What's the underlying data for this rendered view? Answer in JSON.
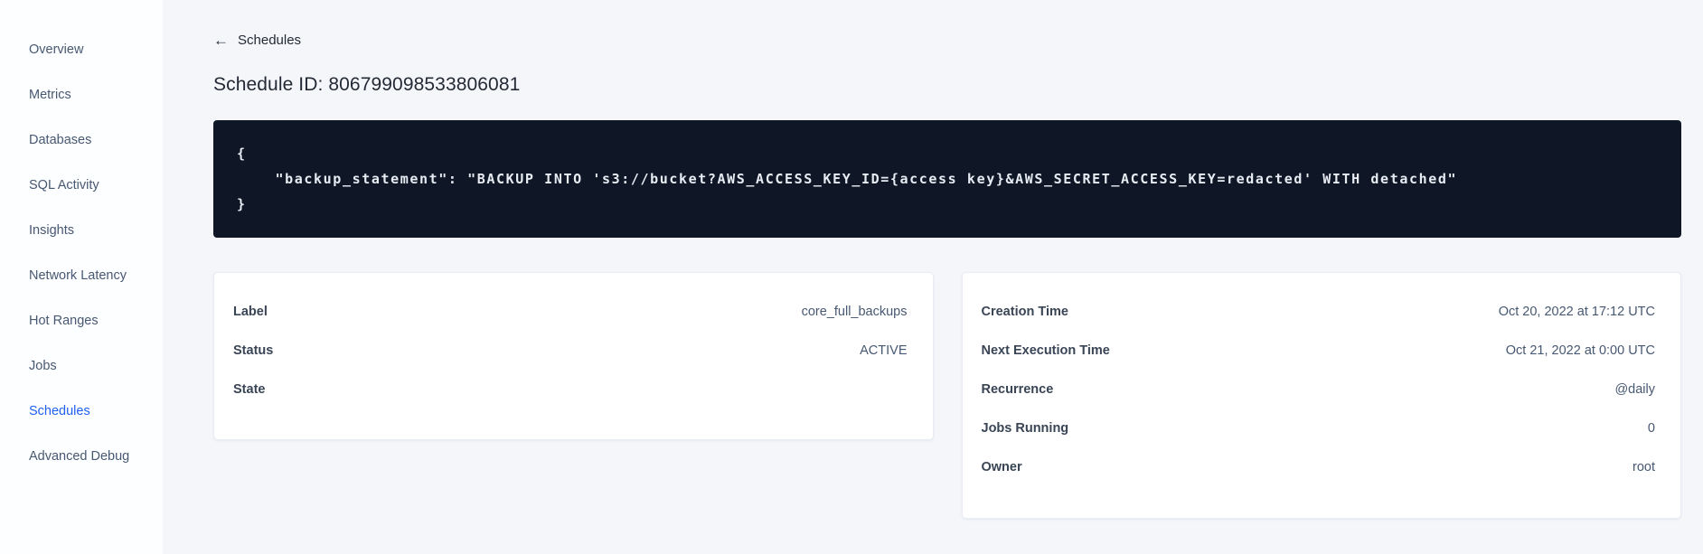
{
  "sidebar": {
    "items": [
      {
        "label": "Overview",
        "active": false
      },
      {
        "label": "Metrics",
        "active": false
      },
      {
        "label": "Databases",
        "active": false
      },
      {
        "label": "SQL Activity",
        "active": false
      },
      {
        "label": "Insights",
        "active": false
      },
      {
        "label": "Network Latency",
        "active": false
      },
      {
        "label": "Hot Ranges",
        "active": false
      },
      {
        "label": "Jobs",
        "active": false
      },
      {
        "label": "Schedules",
        "active": true
      },
      {
        "label": "Advanced Debug",
        "active": false
      }
    ]
  },
  "header": {
    "back_icon": "left-arrow",
    "back_label": "Schedules",
    "title": "Schedule ID: 806799098533806081"
  },
  "code_block": {
    "text": "{\n    \"backup_statement\": \"BACKUP INTO 's3://bucket?AWS_ACCESS_KEY_ID={access key}&AWS_SECRET_ACCESS_KEY=redacted' WITH detached\"\n}"
  },
  "cards": {
    "schedule": {
      "rows": [
        {
          "label": "Label",
          "value": "core_full_backups"
        },
        {
          "label": "Status",
          "value": "ACTIVE"
        },
        {
          "label": "State",
          "value": ""
        }
      ]
    },
    "execution": {
      "rows": [
        {
          "label": "Creation Time",
          "value": "Oct 20, 2022 at 17:12 UTC"
        },
        {
          "label": "Next Execution Time",
          "value": "Oct 21, 2022 at 0:00 UTC"
        },
        {
          "label": "Recurrence",
          "value": "@daily"
        },
        {
          "label": "Jobs Running",
          "value": "0"
        },
        {
          "label": "Owner",
          "value": "root"
        }
      ]
    }
  },
  "colors": {
    "accent_blue": "#2160f0",
    "code_background": "#0f1726",
    "code_text": "#e7ecf3",
    "page_background": "#f4f6fa",
    "heading_text": "#242a35",
    "label_text": "#394455",
    "body_text": "#475872"
  }
}
